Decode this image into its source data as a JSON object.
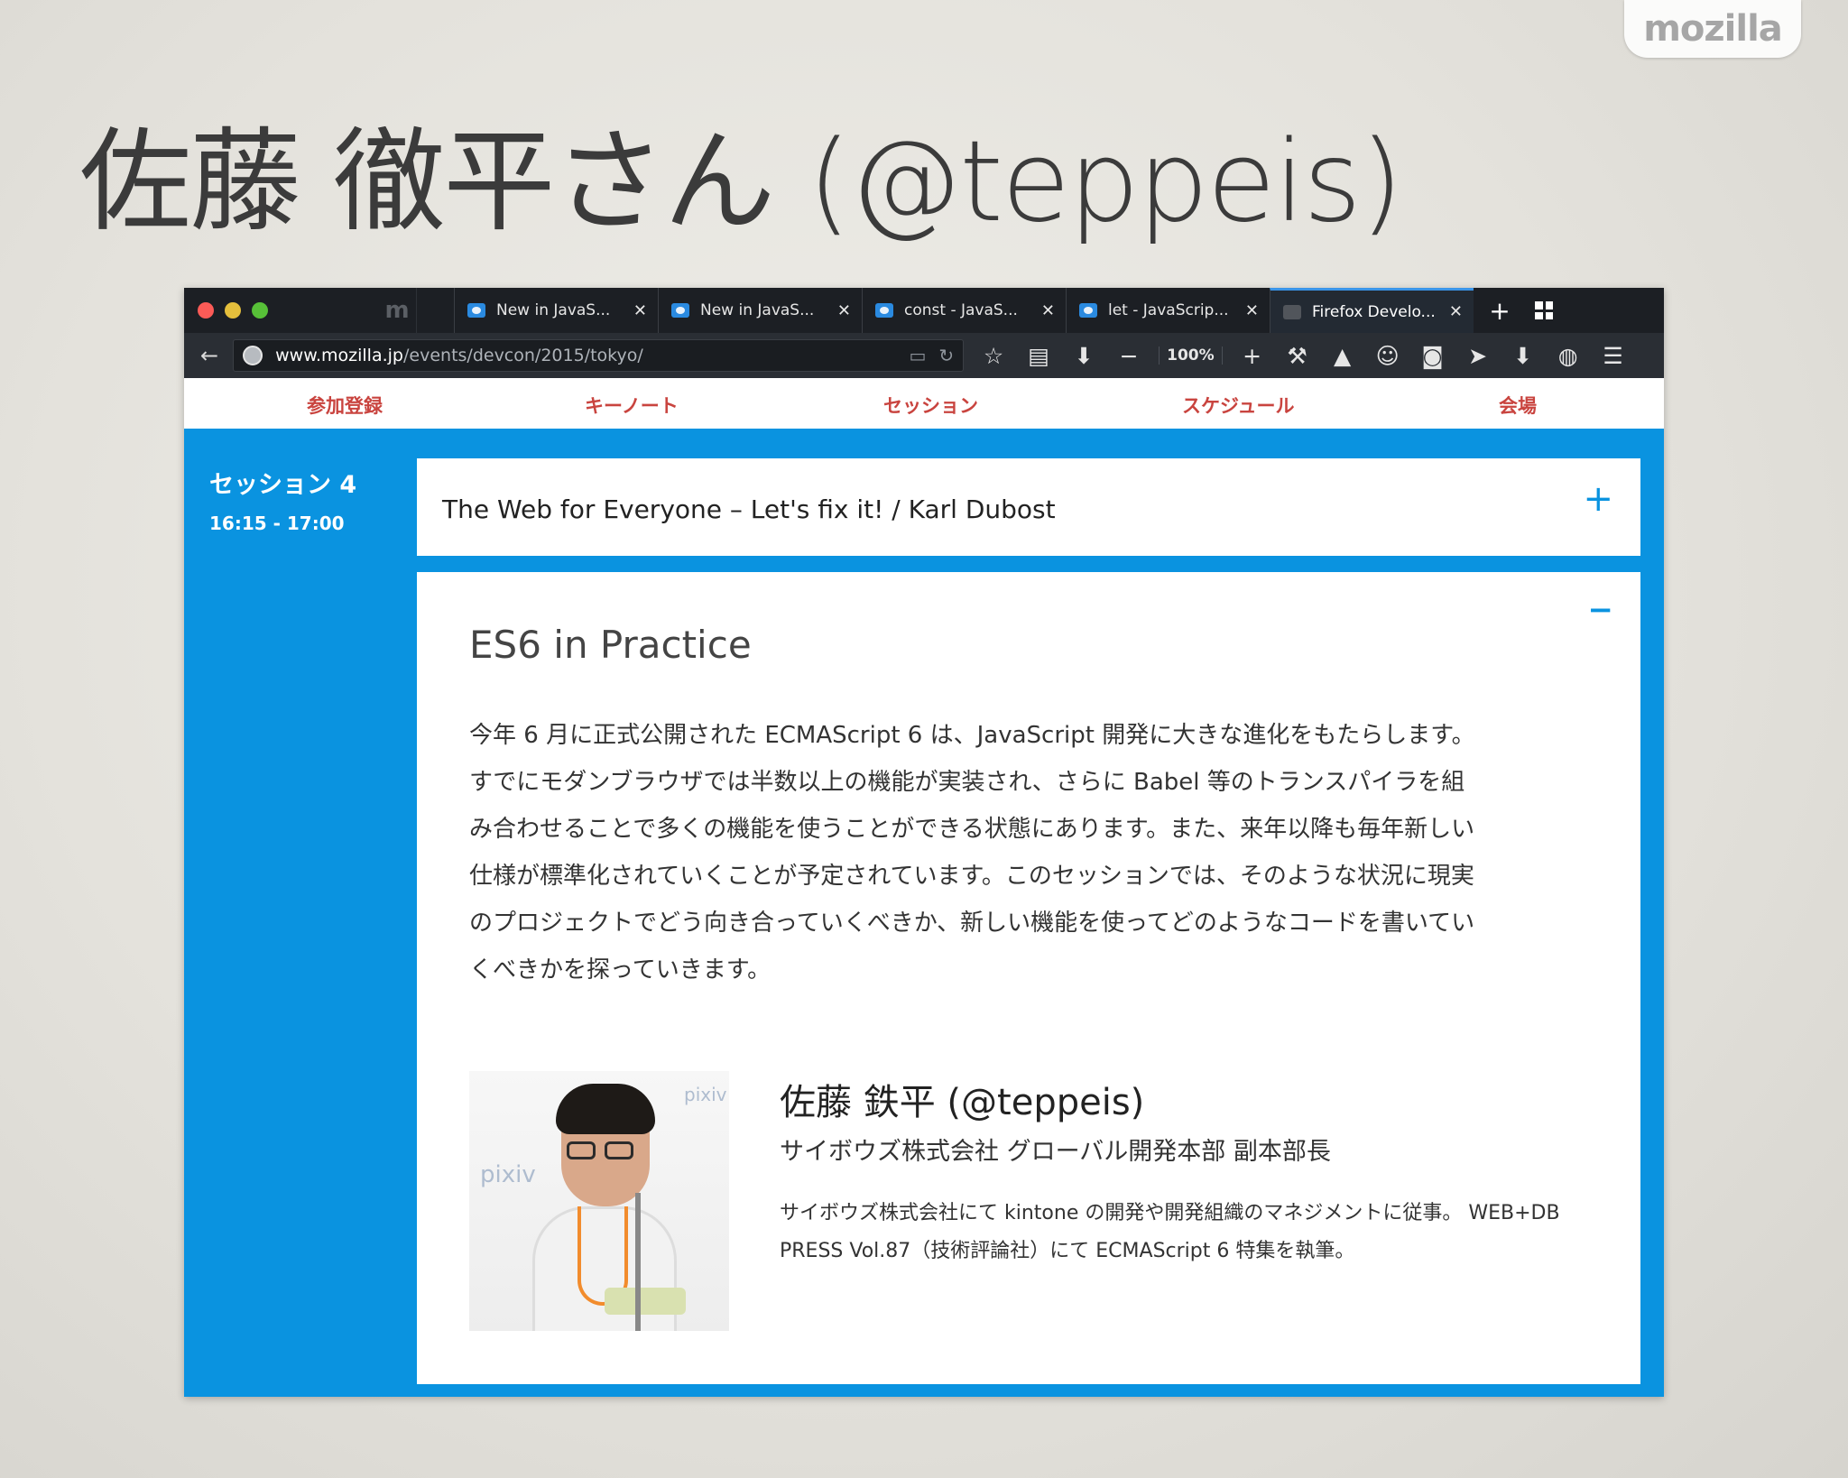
{
  "brand": {
    "label": "mozilla"
  },
  "slide": {
    "title": "佐藤 徹平さん (@teppeis)"
  },
  "browser": {
    "pinned_tabs": [
      "m",
      ""
    ],
    "tabs": [
      {
        "label": "New in JavaS...",
        "favicon": "mdn-favicon"
      },
      {
        "label": "New in JavaS...",
        "favicon": "mdn-favicon"
      },
      {
        "label": "const - JavaS...",
        "favicon": "mdn-favicon"
      },
      {
        "label": "let - JavaScrip...",
        "favicon": "mdn-favicon"
      },
      {
        "label": "Firefox Develo...",
        "favicon": "mozilla-favicon",
        "active": true
      }
    ],
    "url": {
      "host": "www.mozilla.jp",
      "path": "/events/devcon/2015/tokyo/"
    },
    "zoom": "100%"
  },
  "site_nav": {
    "items": [
      "参加登録",
      "キーノート",
      "セッション",
      "スケジュール",
      "会場"
    ],
    "color": "#c9443f"
  },
  "session": {
    "name": "セッション 4",
    "time": "16:15 - 17:00"
  },
  "talk_collapsed": {
    "title": "The Web for Everyone – Let's fix it!   /  Karl Dubost",
    "toggle": "+"
  },
  "talk_expanded": {
    "toggle": "−",
    "heading": "ES6 in Practice",
    "description_lines": [
      "今年 6 月に正式公開された ECMAScript 6 は、JavaScript 開発に大きな進化をもたらします。",
      "すでにモダンブラウザでは半数以上の機能が実装され、さらに Babel 等のトランスパイラを組",
      "み合わせることで多くの機能を使うことができる状態にあります。また、来年以降も毎年新しい",
      "仕様が標準化されていくことが予定されています。このセッションでは、そのような状況に現実",
      "のプロジェクトでどう向き合っていくべきか、新しい機能を使ってどのようなコードを書いてい",
      "くべきかを探っていきます。"
    ],
    "speaker": {
      "name": "佐藤 鉄平 (@teppeis)",
      "role": "サイボウズ株式会社 グローバル開発本部 副本部長",
      "bio_lines": [
        "サイボウズ株式会社にて kintone の開発や開発組織のマネジメントに従事。 WEB+DB",
        "PRESS Vol.87（技術評論社）にて ECMAScript 6 特集を執筆。"
      ],
      "backdrop_text": [
        "pixiv",
        "pixiv"
      ]
    }
  },
  "colors": {
    "accent": "#0a93e0",
    "tabbar": "#1c1f24",
    "navbar": "#2a2e34"
  }
}
